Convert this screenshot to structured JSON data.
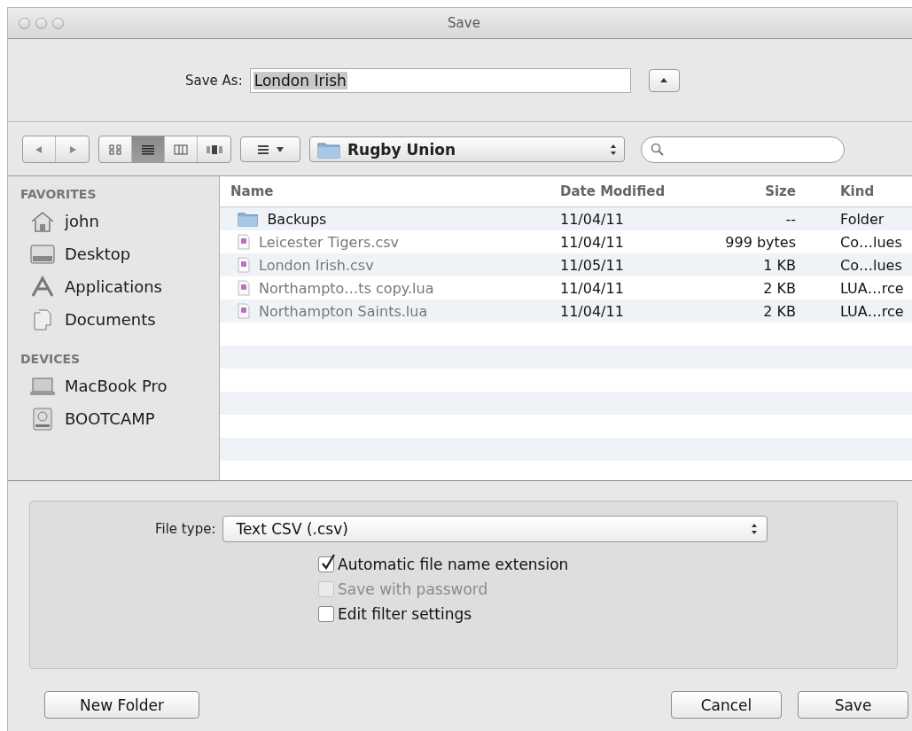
{
  "window": {
    "title": "Save"
  },
  "save_as": {
    "label": "Save As:",
    "value": "London Irish",
    "expanded": false
  },
  "toolbar": {
    "view_modes": [
      {
        "kind": "icons",
        "selected": false
      },
      {
        "kind": "list",
        "selected": true
      },
      {
        "kind": "columns",
        "selected": false
      },
      {
        "kind": "coverflow",
        "selected": false
      }
    ],
    "location": "Rugby Union"
  },
  "sidebar": {
    "sections": [
      {
        "heading": "FAVORITES",
        "items": [
          {
            "label": "john",
            "kind": "home"
          },
          {
            "label": "Desktop",
            "kind": "desktop"
          },
          {
            "label": "Applications",
            "kind": "applications"
          },
          {
            "label": "Documents",
            "kind": "documents"
          }
        ]
      },
      {
        "heading": "DEVICES",
        "items": [
          {
            "label": "MacBook Pro",
            "kind": "laptop"
          },
          {
            "label": "BOOTCAMP",
            "kind": "disk"
          }
        ]
      }
    ]
  },
  "table": {
    "columns": [
      "Name",
      "Date Modified",
      "Size",
      "Kind"
    ],
    "rows": [
      {
        "kind": "folder",
        "name": "Backups",
        "date": "11/04/11",
        "size": "--",
        "type": "Folder",
        "disabled": false
      },
      {
        "kind": "file",
        "name": "Leicester Tigers.csv",
        "date": "11/04/11",
        "size": "999 bytes",
        "type": "Co…lues",
        "disabled": true
      },
      {
        "kind": "file",
        "name": "London Irish.csv",
        "date": "11/05/11",
        "size": "1 KB",
        "type": "Co…lues",
        "disabled": true
      },
      {
        "kind": "file",
        "name": "Northampto…ts copy.lua",
        "date": "11/04/11",
        "size": "2 KB",
        "type": "LUA…rce",
        "disabled": true
      },
      {
        "kind": "file",
        "name": "Northampton Saints.lua",
        "date": "11/04/11",
        "size": "2 KB",
        "type": "LUA…rce",
        "disabled": true
      }
    ]
  },
  "options": {
    "file_type": {
      "label": "File type:",
      "value": "Text CSV (.csv)"
    },
    "checkboxes": [
      {
        "label": "Automatic file name extension",
        "checked": true,
        "disabled": false
      },
      {
        "label": "Save with password",
        "checked": false,
        "disabled": true
      },
      {
        "label": "Edit filter settings",
        "checked": false,
        "disabled": false
      }
    ]
  },
  "buttons": {
    "left": [
      "New Folder"
    ],
    "right": [
      "Cancel",
      "Save"
    ]
  }
}
